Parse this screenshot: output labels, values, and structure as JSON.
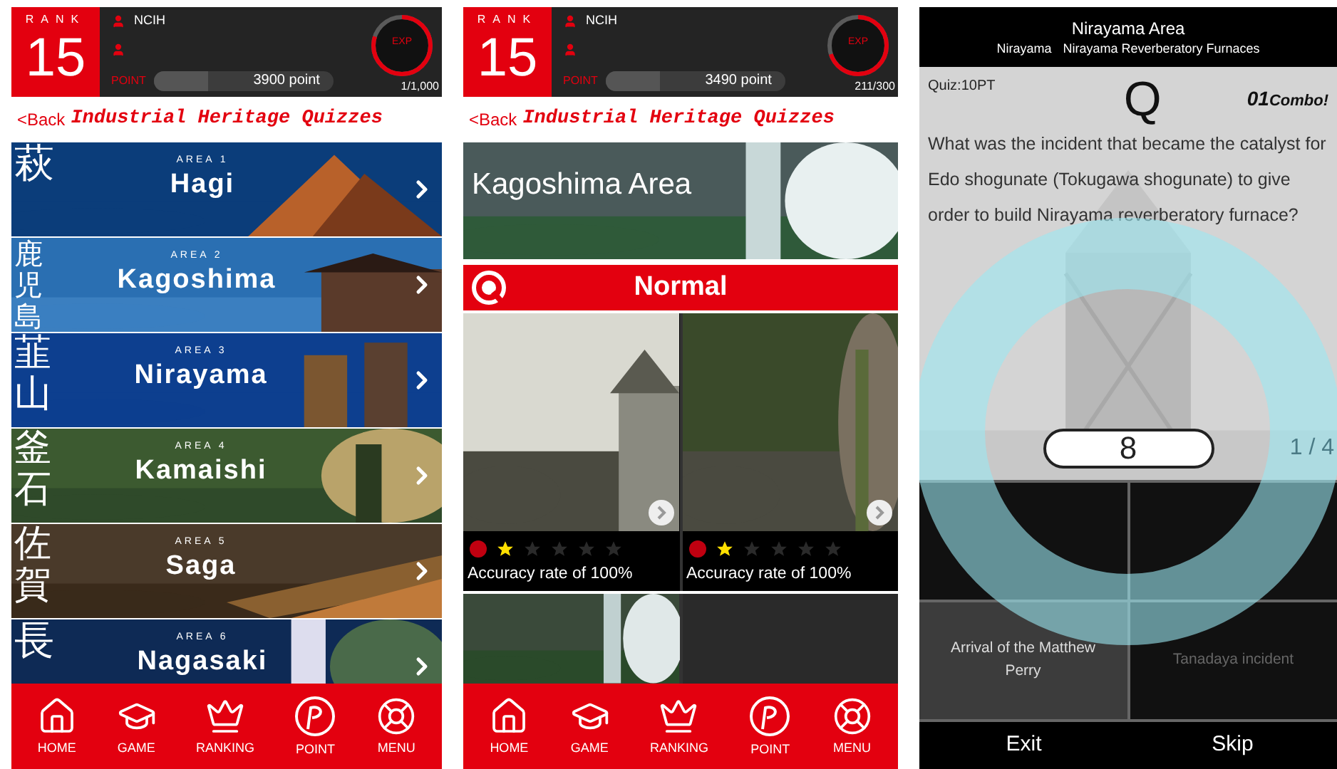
{
  "area_list_screen": {
    "header": {
      "rank_label": "RANK",
      "rank": "15",
      "user": "NCIH",
      "point": {
        "label": "POINT",
        "reading": "3900 point",
        "level": 0.3
      },
      "exp": {
        "label": "EXP",
        "reading": "1/1,000",
        "level": 0.8
      }
    },
    "back": "<Back",
    "title": "Industrial Heritage Quizzes",
    "areas": [
      {
        "kanji": "萩",
        "area_label": "AREA 1",
        "name": "Hagi"
      },
      {
        "kanji": "鹿児島",
        "area_label": "AREA 2",
        "name": "Kagoshima"
      },
      {
        "kanji": "韮山",
        "area_label": "AREA 3",
        "name": "Nirayama"
      },
      {
        "kanji": "釜石",
        "area_label": "AREA 4",
        "name": "Kamaishi"
      },
      {
        "kanji": "佐賀",
        "area_label": "AREA 5",
        "name": "Saga"
      },
      {
        "kanji": "長",
        "area_label": "AREA 6",
        "name": "Nagasaki"
      }
    ],
    "nav": [
      {
        "label": "HOME",
        "kind": "home"
      },
      {
        "label": "GAME",
        "kind": "game"
      },
      {
        "label": "RANKING",
        "kind": "ranking"
      },
      {
        "label": "POINT",
        "kind": "point"
      },
      {
        "label": "MENU",
        "kind": "menu"
      }
    ]
  },
  "area_detail_screen": {
    "header": {
      "rank_label": "RANK",
      "rank": "15",
      "user": "NCIH",
      "point": {
        "label": "POINT",
        "reading": "3490 point",
        "level": 0.3
      },
      "exp": {
        "label": "EXP",
        "reading": "211/300",
        "level": 0.7
      }
    },
    "back": "<Back",
    "title": "Industrial Heritage Quizzes",
    "area_title": "Kagoshima Area",
    "difficulty": "Normal",
    "cards": [
      {
        "stars": 1,
        "accuracy": "Accuracy rate of 100%"
      },
      {
        "stars": 1,
        "accuracy": "Accuracy rate of 100%"
      }
    ],
    "nav": [
      {
        "label": "HOME",
        "kind": "home"
      },
      {
        "label": "GAME",
        "kind": "game"
      },
      {
        "label": "RANKING",
        "kind": "ranking"
      },
      {
        "label": "POINT",
        "kind": "point"
      },
      {
        "label": "MENU",
        "kind": "menu"
      }
    ]
  },
  "quiz_screen": {
    "title": "Nirayama Area",
    "subtitle_area": "Nirayama",
    "subtitle_site": "Nirayama Reverberatory Furnaces",
    "quiz_points": "Quiz:10PT",
    "q_mark": "Q",
    "combo_count": "01",
    "combo_label": "Combo!",
    "question": "What was the incident that became the catalyst for Edo shogunate (Tokugawa shogunate) to give order to build Nirayama reverberatory furnace?",
    "timer": "8",
    "progress": "1 / 4",
    "answers": [
      {
        "kind": "hidden",
        "selected": false
      },
      {
        "kind": "hidden",
        "selected": false
      },
      {
        "kind": "text",
        "text": "Arrival of the Matthew Perry",
        "selected": true
      },
      {
        "kind": "text",
        "text": "Tanadaya incident",
        "selected": false
      }
    ],
    "buttons": [
      "Exit",
      "Skip"
    ]
  }
}
